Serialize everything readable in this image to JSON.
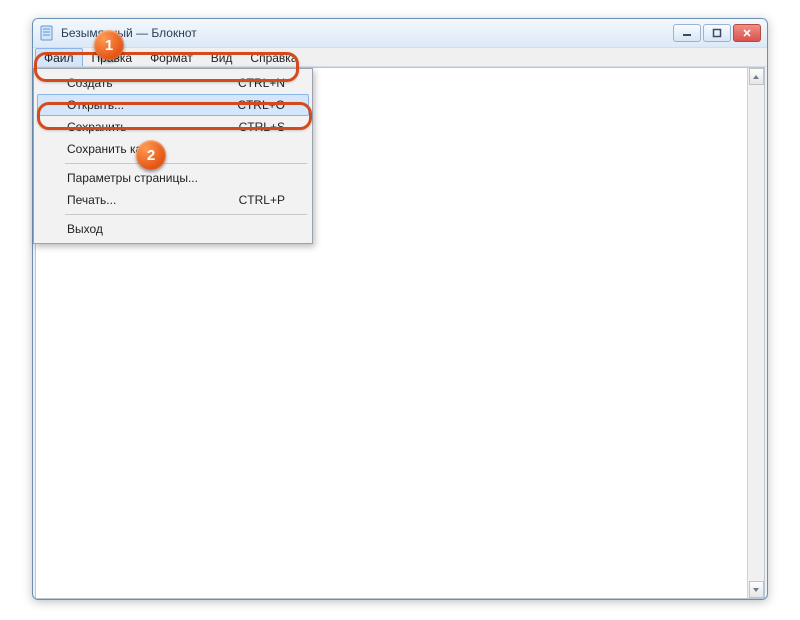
{
  "window": {
    "title": "Безымянный — Блокнот"
  },
  "menubar": {
    "file": "Файл",
    "edit": "Правка",
    "format": "Формат",
    "view": "Вид",
    "help": "Справка"
  },
  "file_menu": {
    "new": {
      "label": "Создать",
      "shortcut": "CTRL+N"
    },
    "open": {
      "label": "Открыть...",
      "shortcut": "CTRL+O"
    },
    "save": {
      "label": "Сохранить",
      "shortcut": "CTRL+S"
    },
    "save_as": {
      "label": "Сохранить как...",
      "shortcut": ""
    },
    "page_setup": {
      "label": "Параметры страницы...",
      "shortcut": ""
    },
    "print": {
      "label": "Печать...",
      "shortcut": "CTRL+P"
    },
    "exit": {
      "label": "Выход",
      "shortcut": ""
    }
  },
  "annotations": {
    "badge1": "1",
    "badge2": "2"
  }
}
